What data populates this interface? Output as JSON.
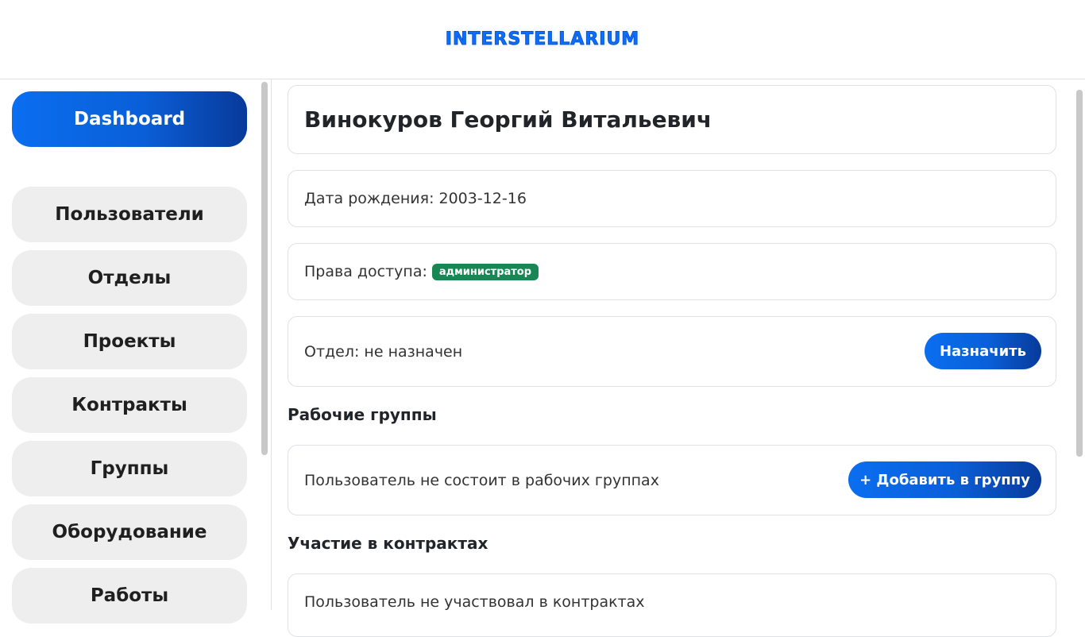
{
  "header": {
    "logo_text": "INTERSTELLARIUM"
  },
  "sidebar": {
    "items": [
      {
        "label": "Dashboard",
        "active": true
      },
      {
        "label": "Пользователи"
      },
      {
        "label": "Отделы"
      },
      {
        "label": "Проекты"
      },
      {
        "label": "Контракты"
      },
      {
        "label": "Группы"
      },
      {
        "label": "Оборудование"
      },
      {
        "label": "Работы"
      }
    ]
  },
  "profile": {
    "full_name": "Винокуров Георгий Витальевич",
    "birth_date": "Дата рождения: 2003-12-16",
    "access_label": "Права доступа:",
    "access_badge": "администратор",
    "department": "Отдел: не назначен",
    "assign_button": "Назначить"
  },
  "work_groups": {
    "title": "Рабочие группы",
    "empty_text": "Пользователь не состоит в рабочих группах",
    "add_button": "+ Добавить в группу"
  },
  "contracts": {
    "title": "Участие в контрактах",
    "empty_text": "Пользователь не участвовал в контрактах"
  },
  "colors": {
    "accent": "#0a6ef0",
    "accent_dark": "#083a9a",
    "badge_green": "#198754"
  }
}
